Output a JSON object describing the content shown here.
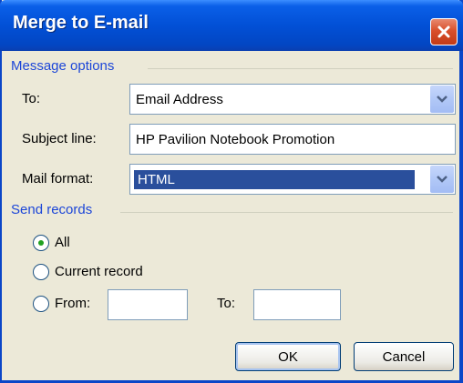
{
  "window": {
    "title": "Merge to E-mail"
  },
  "message_options": {
    "heading": "Message options",
    "to_label": "To:",
    "to_value": "Email Address",
    "subject_label": "Subject line:",
    "subject_value": "HP Pavilion Notebook Promotion",
    "format_label": "Mail format:",
    "format_value": "HTML"
  },
  "send_records": {
    "heading": "Send records",
    "all_label": "All",
    "current_label": "Current record",
    "from_label": "From:",
    "from_value": "",
    "to_label": "To:",
    "to_value": "",
    "selected": "All"
  },
  "buttons": {
    "ok": "OK",
    "cancel": "Cancel"
  },
  "colors": {
    "title_bar": "#0250d6",
    "group_heading": "#1c46d8",
    "dialog_bg": "#ece9d8",
    "selection": "#2a4f9c"
  },
  "icons": {
    "close": "close-icon",
    "dropdown": "chevron-down-icon"
  }
}
